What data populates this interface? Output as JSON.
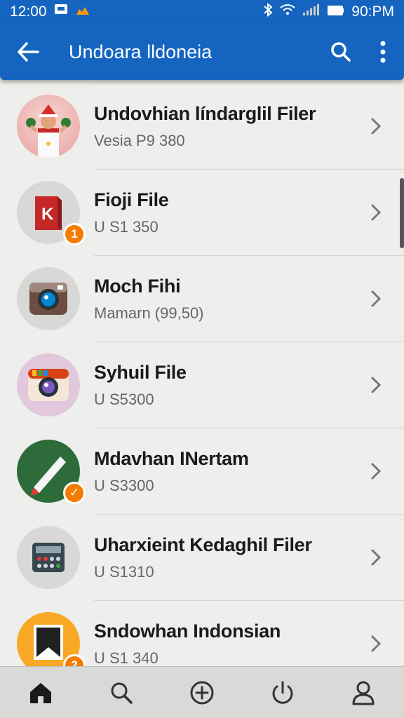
{
  "status": {
    "time_left": "12:00",
    "time_right": "90:PM"
  },
  "app_bar": {
    "title": "Undoara lldoneia"
  },
  "items": [
    {
      "title": "Undovhian líndarglil Filer",
      "subtitle": "Vesia P9 380",
      "icon": "person-avatar-icon",
      "badge": ""
    },
    {
      "title": "Fioji File",
      "subtitle": "U S1 350",
      "icon": "k-book-icon",
      "badge": "1"
    },
    {
      "title": "Moch Fihi",
      "subtitle": "Mamarn (99,50)",
      "icon": "camera-icon",
      "badge": ""
    },
    {
      "title": "Syhuil File",
      "subtitle": "U S5300",
      "icon": "instagram-camera-icon",
      "badge": ""
    },
    {
      "title": "Mdavhan INertam",
      "subtitle": "U S3300",
      "icon": "pen-icon",
      "badge": "✓"
    },
    {
      "title": "Uharxieint Kedaghil Filer",
      "subtitle": "U S1310",
      "icon": "calculator-icon",
      "badge": ""
    },
    {
      "title": "Sndowhan Indonsian",
      "subtitle": "U S1 340",
      "icon": "bookmark-icon",
      "badge": "2"
    }
  ],
  "colors": {
    "primary": "#1565c0",
    "badge": "#f57c00"
  }
}
